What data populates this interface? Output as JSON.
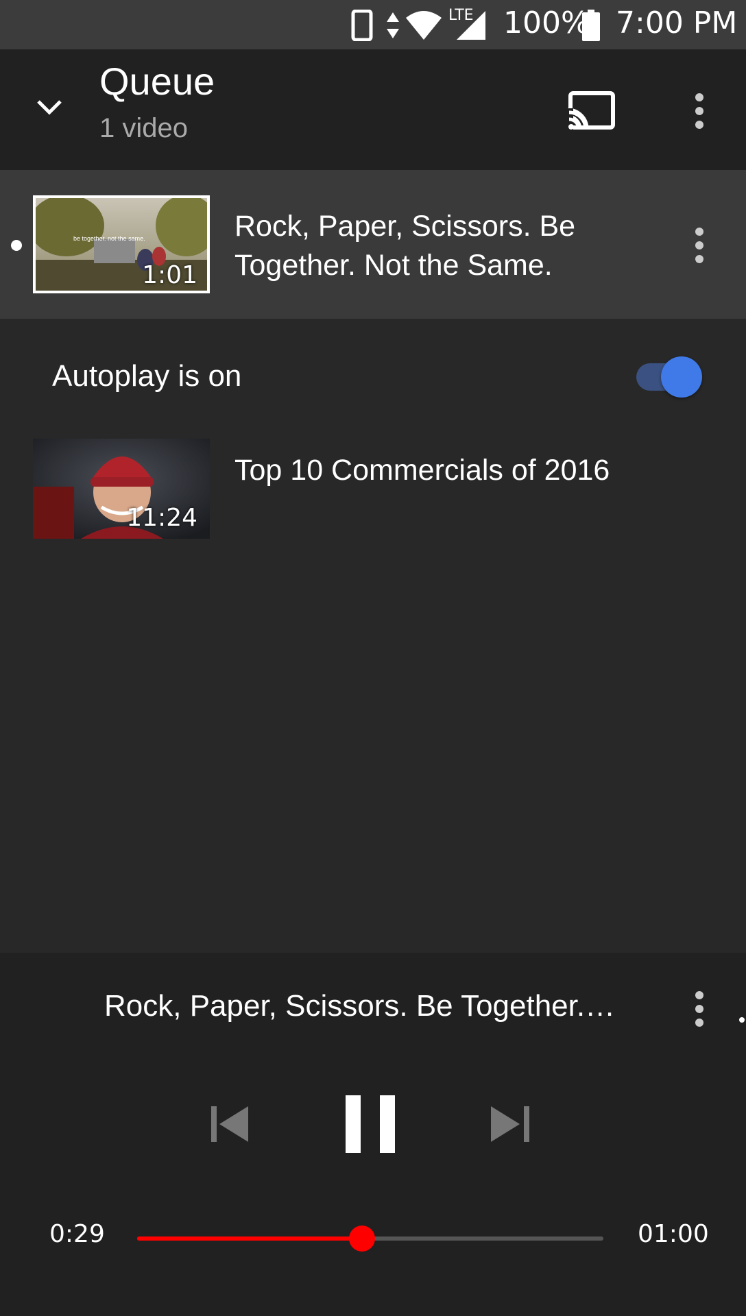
{
  "status_bar": {
    "battery": "100%",
    "time": "7:00 PM",
    "network_label": "LTE",
    "icons": [
      "phone-icon",
      "data-arrows-icon",
      "wifi-icon",
      "lte-signal-icon",
      "battery-icon"
    ]
  },
  "header": {
    "title": "Queue",
    "subtitle": "1 video",
    "icons": [
      "chevron-down-icon",
      "cast-icon",
      "more-vert-icon"
    ]
  },
  "queue": {
    "items": [
      {
        "title": "Rock, Paper, Scissors. Be Together. Not the Same.",
        "duration": "1:01",
        "thumbnail_text": "be together. not the same.",
        "is_playing": true
      }
    ]
  },
  "autoplay": {
    "label": "Autoplay is on",
    "enabled": true
  },
  "up_next": {
    "title": "Top 10 Commercials of 2016",
    "duration": "11:24"
  },
  "player": {
    "title": "Rock, Paper, Scissors. Be Together.…",
    "current_time": "0:29",
    "total_time": "01:00",
    "progress_fraction": 0.483,
    "icons": [
      "skip-previous-icon",
      "pause-icon",
      "skip-next-icon",
      "more-vert-icon"
    ]
  },
  "colors": {
    "accent_red": "#ff0000",
    "toggle_blue": "#3f7ae8",
    "background": "#282828",
    "header_bg": "#212121"
  }
}
